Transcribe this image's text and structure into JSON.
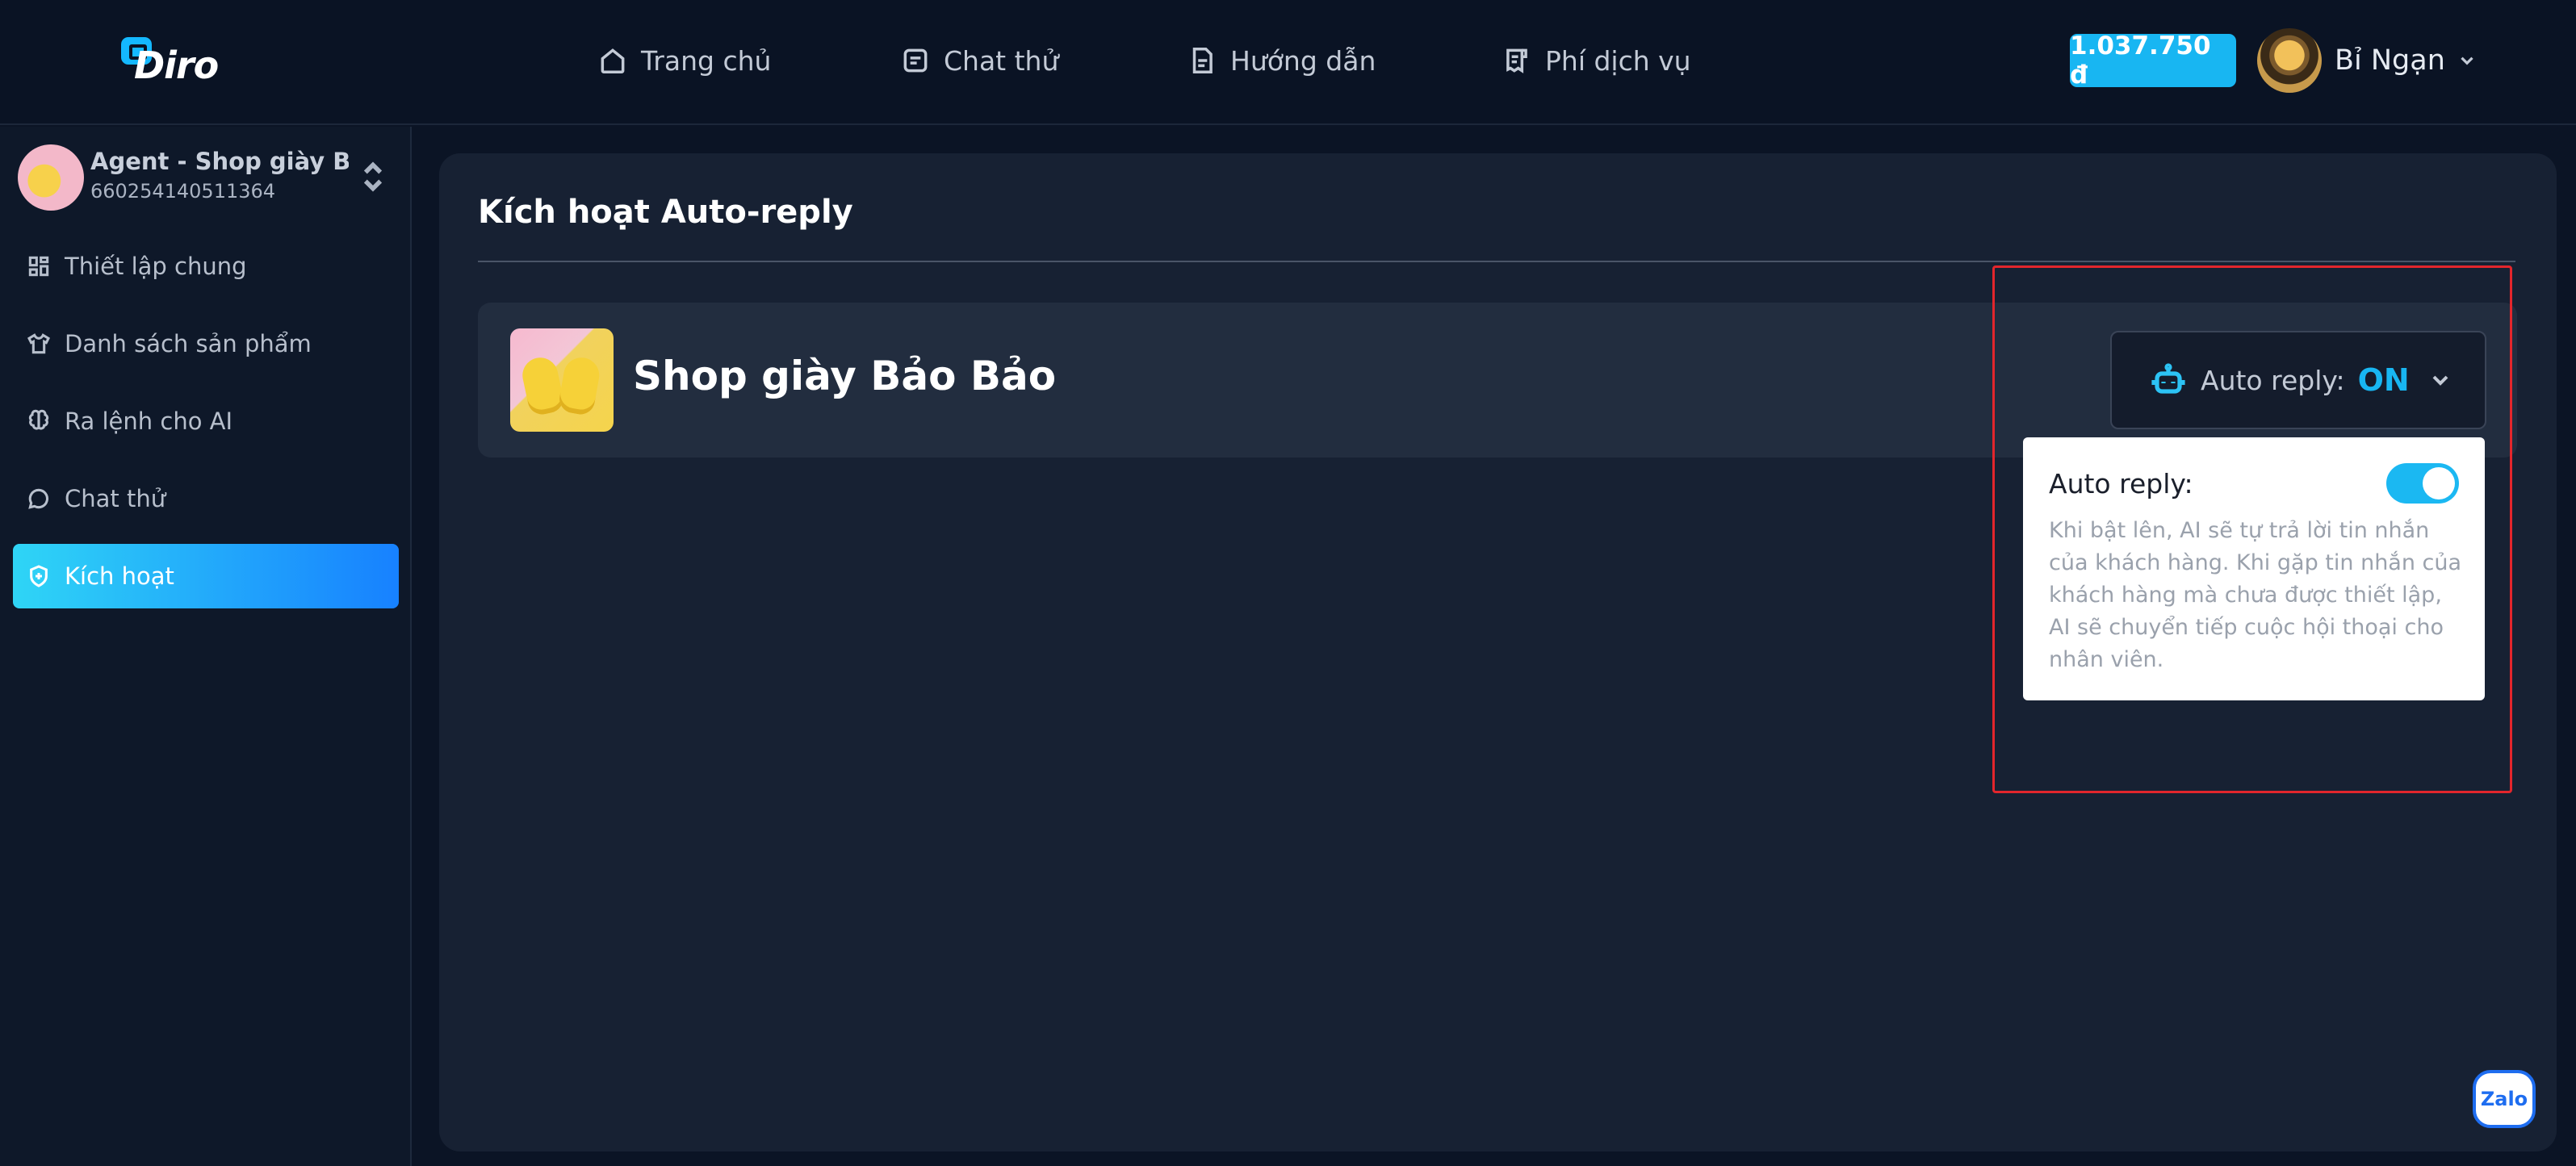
{
  "header": {
    "logo_text": "Diro",
    "nav": [
      {
        "label": "Trang chủ",
        "icon": "home-icon"
      },
      {
        "label": "Chat thử",
        "icon": "chat-square-icon"
      },
      {
        "label": "Hướng dẫn",
        "icon": "document-icon"
      },
      {
        "label": "Phí dịch vụ",
        "icon": "receipt-icon"
      }
    ],
    "balance": "1.037.750 đ",
    "user_name": "Bỉ Ngạn"
  },
  "sidebar": {
    "agent_name": "Agent - Shop giày B...",
    "agent_id": "660254140511364",
    "items": [
      {
        "label": "Thiết lập chung",
        "icon": "grid-icon",
        "active": false
      },
      {
        "label": "Danh sách sản phẩm",
        "icon": "shirt-icon",
        "active": false
      },
      {
        "label": "Ra lệnh cho AI",
        "icon": "brain-icon",
        "active": false
      },
      {
        "label": "Chat thử",
        "icon": "chat-bubble-icon",
        "active": false
      },
      {
        "label": "Kích hoạt",
        "icon": "shield-plus-icon",
        "active": true
      }
    ]
  },
  "main": {
    "title": "Kích hoạt Auto-reply",
    "shop_name": "Shop giày Bảo Bảo",
    "autoreply_label": "Auto reply:",
    "autoreply_value": "ON",
    "popover": {
      "title": "Auto reply:",
      "toggle_on": true,
      "description": "Khi bật lên, AI sẽ tự trả lời tin nhắn của khách hàng. Khi gặp tin nhắn của khách hàng mà chưa được thiết lập, AI sẽ chuyển tiếp cuộc hội thoại cho nhân viên."
    }
  },
  "zalo": {
    "label": "Zalo"
  },
  "colors": {
    "accent": "#18b6f2",
    "highlight": "#e3262c",
    "background": "#0b1425"
  }
}
